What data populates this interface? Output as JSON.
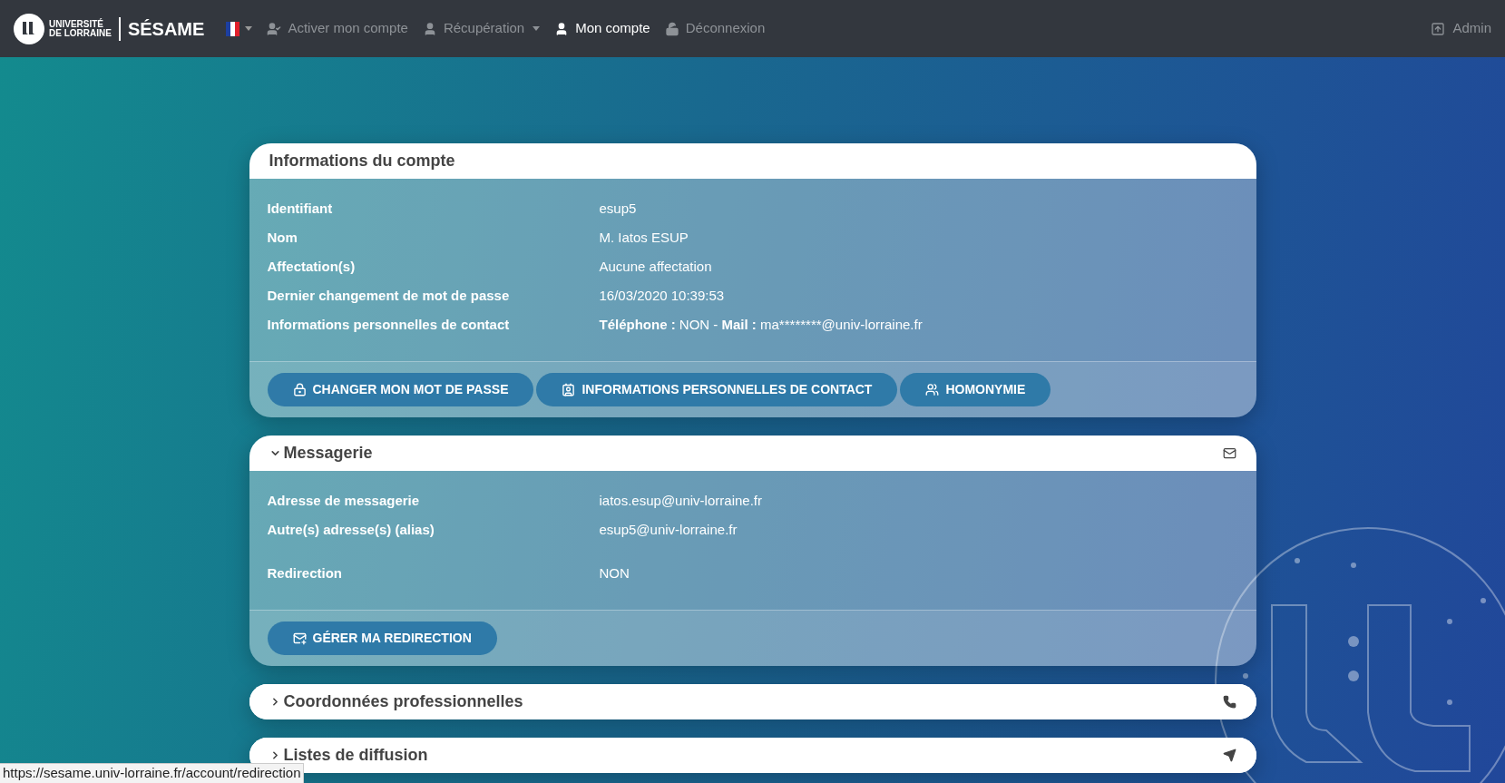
{
  "navbar": {
    "brand": {
      "line_1": "UNIVERSITÉ",
      "line_2": "DE LORRAINE",
      "name": "SÉSAME"
    },
    "items": [
      {
        "label": "Activer mon compte",
        "selected": false,
        "dropdown": false
      },
      {
        "label": "Récupération",
        "selected": false,
        "dropdown": true
      },
      {
        "label": "Mon compte",
        "selected": true,
        "dropdown": false
      },
      {
        "label": "Déconnexion",
        "selected": false,
        "dropdown": false
      }
    ],
    "admin": "Admin"
  },
  "cards": [
    {
      "title": "Informations du compte",
      "kind": "static",
      "rows": [
        {
          "label": "Identifiant",
          "value": "esup5"
        },
        {
          "label": "Nom",
          "value": "M. Iatos ESUP"
        },
        {
          "label": "Affectation(s)",
          "value": "Aucune affectation"
        },
        {
          "label": "Dernier changement de mot de passe",
          "value": "16/03/2020 10:39:53"
        },
        {
          "label": "Informations personnelles de contact",
          "parts": [
            {
              "text": "Téléphone :",
              "bold": true
            },
            {
              "text": " NON - ",
              "bold": false
            },
            {
              "text": "Mail :",
              "bold": true
            },
            {
              "text": " ma********@univ-lorraine.fr",
              "bold": false
            }
          ]
        }
      ],
      "buttons": [
        "CHANGER MON MOT DE PASSE",
        "INFORMATIONS PERSONNELLES DE CONTACT",
        "HOMONYMIE"
      ]
    },
    {
      "title": "Messagerie",
      "kind": "collapsible",
      "expanded": true,
      "rows": [
        {
          "label": "Adresse de messagerie",
          "value": "iatos.esup@univ-lorraine.fr"
        },
        {
          "label": "Autre(s) adresse(s) (alias)",
          "value": "esup5@univ-lorraine.fr"
        },
        {
          "label": "Redirection",
          "value": "NON"
        }
      ],
      "buttons": [
        "GÉRER MA REDIRECTION"
      ]
    },
    {
      "title": "Coordonnées professionnelles",
      "kind": "collapsible",
      "expanded": false
    },
    {
      "title": "Listes de diffusion",
      "kind": "collapsible",
      "expanded": false
    }
  ],
  "status_bar": "https://sesame.univ-lorraine.fr/account/redirection"
}
